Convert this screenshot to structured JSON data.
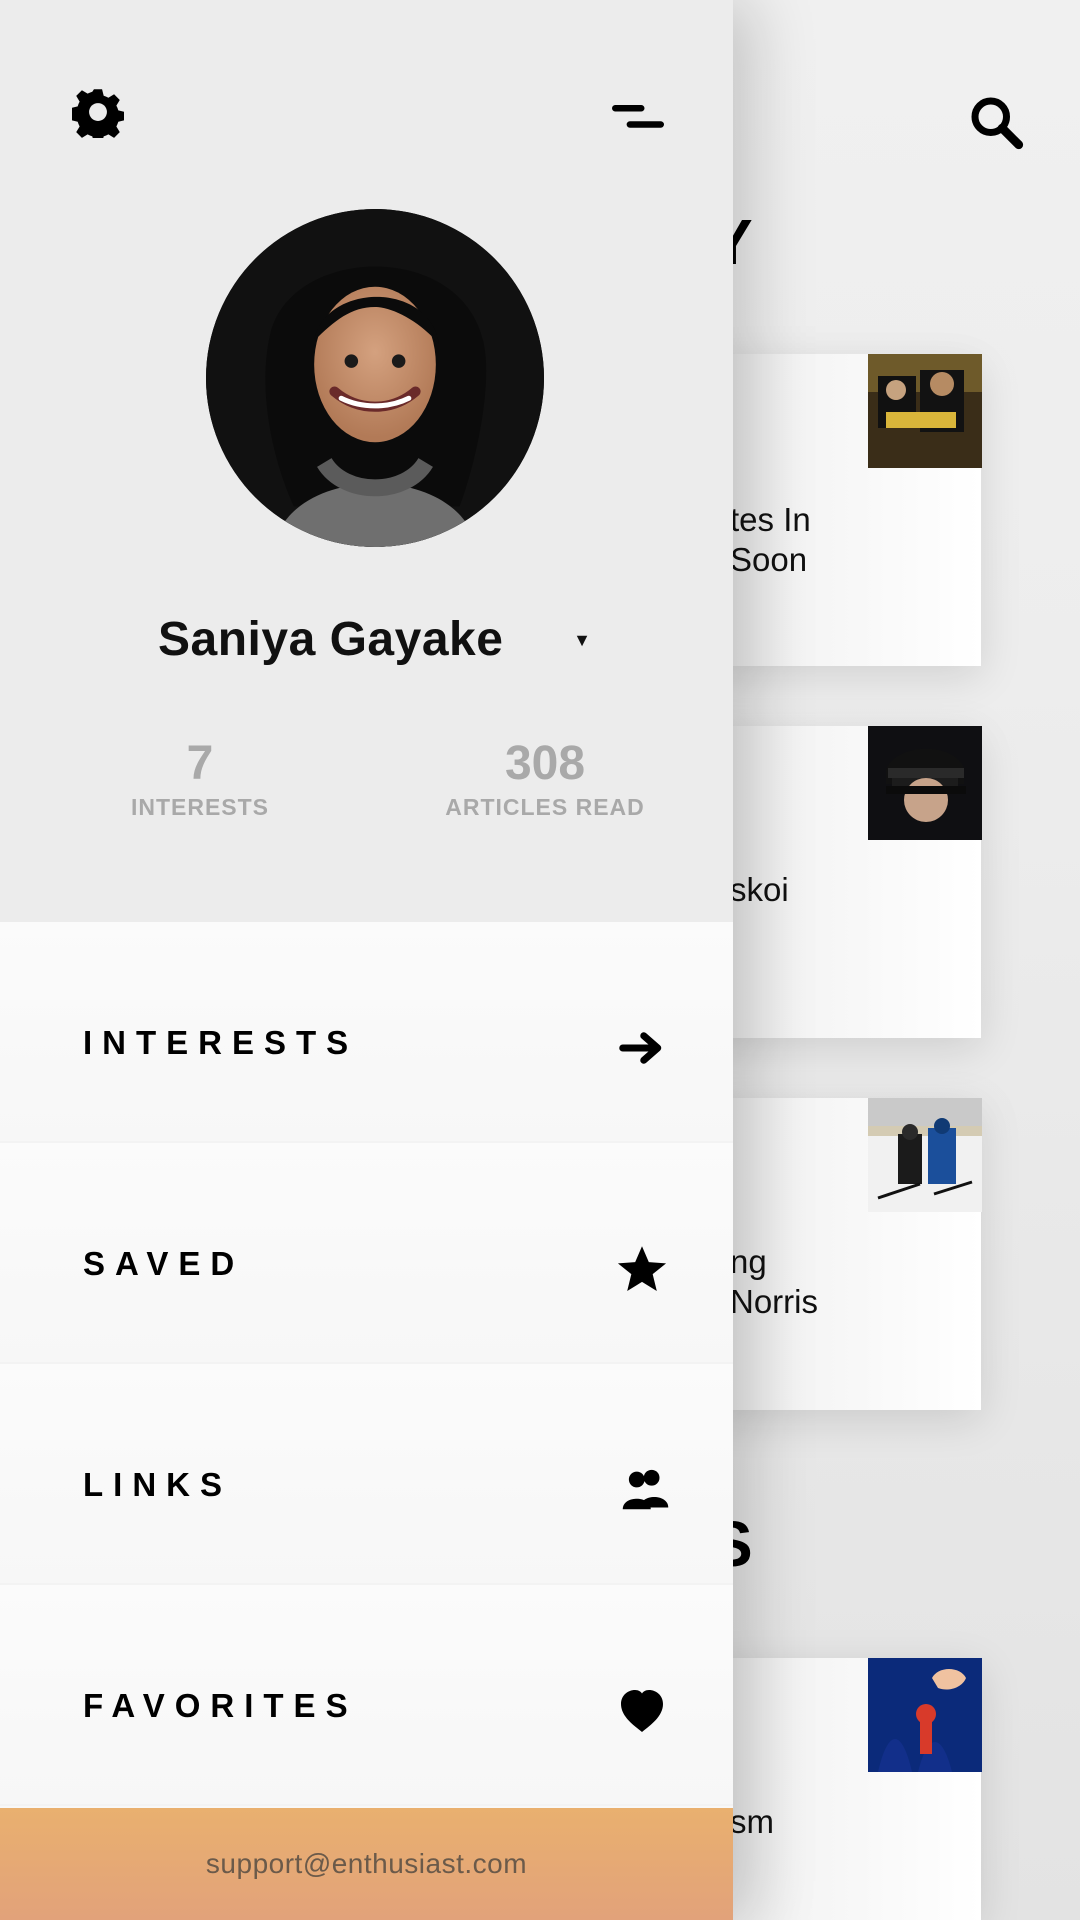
{
  "background_feed": {
    "heading_partial_top": "Y",
    "heading_partial_bottom": "S",
    "cards": [
      {
        "text_line_1": "tes In",
        "text_line_2": "Soon"
      },
      {
        "text_line_1": "skoi",
        "text_line_2": ""
      },
      {
        "text_line_1": "ng",
        "text_line_2": "Norris"
      },
      {
        "text_line_1": "sm",
        "text_line_2": ""
      }
    ]
  },
  "drawer": {
    "user": {
      "name": "Saniya Gayake",
      "stats": {
        "interests": {
          "value": "7",
          "label": "INTERESTS"
        },
        "articles_read": {
          "value": "308",
          "label": "ARTICLES READ"
        }
      }
    },
    "menu": [
      {
        "label": "INTERESTS",
        "icon": "arrow-right-icon"
      },
      {
        "label": "SAVED",
        "icon": "star-icon"
      },
      {
        "label": "LINKS",
        "icon": "users-icon"
      },
      {
        "label": "FAVORITES",
        "icon": "heart-icon"
      }
    ],
    "footer": {
      "email": "support@enthusiast.com",
      "colors": {
        "start": "#e9b06f",
        "end": "#e2a27a"
      }
    }
  }
}
